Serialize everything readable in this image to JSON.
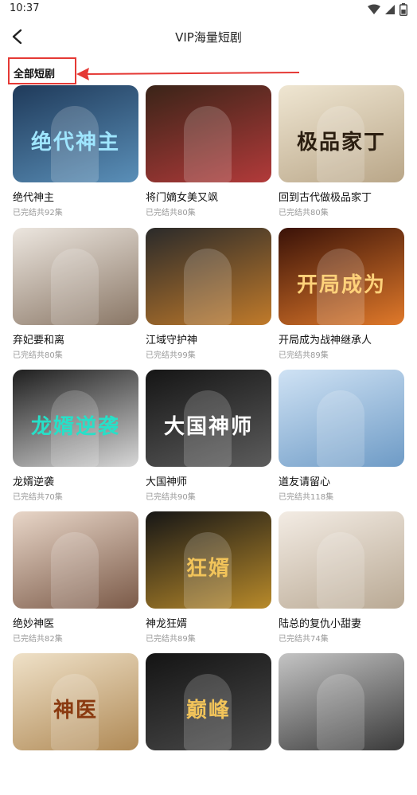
{
  "status": {
    "time": "10:37"
  },
  "header": {
    "title": "VIP海量短剧"
  },
  "section": {
    "title": "全部短剧"
  },
  "dramas": [
    {
      "title": "绝代神主",
      "subtitle": "已完结共92集",
      "poster_text": "绝代神主",
      "colors": [
        "#1f3a5a",
        "#5a8fb8"
      ],
      "text_color": "#9fe6ff"
    },
    {
      "title": "将门嫡女美又飒",
      "subtitle": "已完结共80集",
      "poster_text": "",
      "colors": [
        "#3a2418",
        "#b23a3a"
      ],
      "text_color": "#ffffff"
    },
    {
      "title": "回到古代做极品家丁",
      "subtitle": "已完结共80集",
      "poster_text": "极品家丁",
      "colors": [
        "#efe6d2",
        "#b9a688"
      ],
      "text_color": "#2b1e10"
    },
    {
      "title": "弃妃要和离",
      "subtitle": "已完结共80集",
      "poster_text": "",
      "colors": [
        "#ece6df",
        "#8a7766"
      ],
      "text_color": "#333333"
    },
    {
      "title": "江域守护神",
      "subtitle": "已完结共99集",
      "poster_text": "",
      "colors": [
        "#2a2a2a",
        "#c07a2a"
      ],
      "text_color": "#ffffff"
    },
    {
      "title": "开局成为战神继承人",
      "subtitle": "已完结共89集",
      "poster_text": "开局成为",
      "colors": [
        "#3a1208",
        "#e0792a"
      ],
      "text_color": "#ffd27a"
    },
    {
      "title": "龙婿逆袭",
      "subtitle": "已完结共70集",
      "poster_text": "龙婿逆袭",
      "colors": [
        "#1e1e1e",
        "#d8d8d8"
      ],
      "text_color": "#27e0c8"
    },
    {
      "title": "大国神师",
      "subtitle": "已完结共90集",
      "poster_text": "大国神师",
      "colors": [
        "#151515",
        "#5c5c5c"
      ],
      "text_color": "#ffffff"
    },
    {
      "title": "道友请留心",
      "subtitle": "已完结共118集",
      "poster_text": "",
      "colors": [
        "#cfe2f4",
        "#6e9bc6"
      ],
      "text_color": "#ffffff"
    },
    {
      "title": "绝妙神医",
      "subtitle": "已完结共82集",
      "poster_text": "",
      "colors": [
        "#e8d6c8",
        "#7b5a48"
      ],
      "text_color": "#ffffff"
    },
    {
      "title": "神龙狂婿",
      "subtitle": "已完结共89集",
      "poster_text": "狂婿",
      "colors": [
        "#161616",
        "#b88a2a"
      ],
      "text_color": "#f2c45a"
    },
    {
      "title": "陆总的复仇小甜妻",
      "subtitle": "已完结共74集",
      "poster_text": "",
      "colors": [
        "#f3ece4",
        "#b9a994"
      ],
      "text_color": "#333333"
    },
    {
      "title": "",
      "subtitle": "",
      "poster_text": "神医",
      "colors": [
        "#efe1c8",
        "#b08a56"
      ],
      "text_color": "#8a3a10"
    },
    {
      "title": "",
      "subtitle": "",
      "poster_text": "巅峰",
      "colors": [
        "#141414",
        "#4a4a4a"
      ],
      "text_color": "#f2c45a"
    },
    {
      "title": "",
      "subtitle": "",
      "poster_text": "",
      "colors": [
        "#c4c4c4",
        "#3a3a3a"
      ],
      "text_color": "#ffffff"
    }
  ]
}
